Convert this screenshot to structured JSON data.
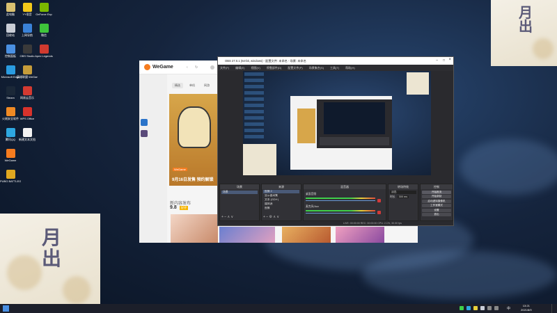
{
  "colors": {
    "wegame_orange": "#f57c1f",
    "obs_bg": "#2a2a2e",
    "record_red": "#d23a3a"
  },
  "desktop_icons": [
    {
      "label": "此电脑",
      "icon": "computer-icon",
      "color": "#d8c070"
    },
    {
      "label": "回收站",
      "icon": "recycle-bin-icon",
      "color": "#c9cdd6"
    },
    {
      "label": "控制面板",
      "icon": "control-panel-icon",
      "color": "#4a90e2"
    },
    {
      "label": "Microsoft Edge",
      "icon": "edge-icon",
      "color": "#2a9be0"
    },
    {
      "label": "Steam",
      "icon": "steam-icon",
      "color": "#1b2838"
    },
    {
      "label": "火绒安全软件",
      "icon": "huorong-icon",
      "color": "#f08a24"
    },
    {
      "label": "腾讯QQ",
      "icon": "qq-icon",
      "color": "#2ea7e0"
    },
    {
      "label": "WeGame",
      "icon": "wegame-icon",
      "color": "#f57c1f"
    },
    {
      "label": "PUBG BATTLEGR",
      "icon": "pubg-icon",
      "color": "#e0a820"
    },
    {
      "label": "YY语音",
      "icon": "yy-icon",
      "color": "#f2c81a"
    },
    {
      "label": "上网导航",
      "icon": "browser-icon",
      "color": "#3a82d8"
    },
    {
      "label": "OBS Studio",
      "icon": "obs-icon",
      "color": "#3a3a3a"
    },
    {
      "label": "英雄联盟 WeGame版",
      "icon": "lol-icon",
      "color": "#c59c3a"
    },
    {
      "label": "网易云音乐",
      "icon": "netease-music-icon",
      "color": "#d33a31"
    },
    {
      "label": "WPS Office",
      "icon": "wps-icon",
      "color": "#d8332c"
    },
    {
      "label": "新建文本文档",
      "icon": "text-doc-icon",
      "color": "#f3f3f3"
    },
    {
      "label": "微信",
      "icon": "wechat-icon",
      "color": "#3ec43b"
    },
    {
      "label": "Apex Legends",
      "icon": "apex-icon",
      "color": "#d03a2f"
    },
    {
      "label": "GeForce Exp",
      "icon": "geforce-icon",
      "color": "#7ab800"
    }
  ],
  "wegame": {
    "logo": "WeGame",
    "nav": [
      "推荐",
      "游戏",
      "商店"
    ],
    "tabs": [
      "精选",
      "单机",
      "网游"
    ],
    "banner_badge": "WeGame",
    "banner_caption": "9月16日发售 预约解锁",
    "section_title": "新内容发布",
    "rating": "9.8",
    "rating_badge": "好评"
  },
  "obs": {
    "title": "OBS 27.0.1 (64-bit, windows) - 配置文件: 未命名 - 场景: 未命名",
    "menu": [
      "文件(F)",
      "编辑(E)",
      "视图(V)",
      "停靠部件(D)",
      "配置文件(P)",
      "场景集合(S)",
      "工具(T)",
      "帮助(H)"
    ],
    "docks": {
      "scenes": "场景",
      "sources": "来源",
      "mixer": "混音器",
      "transitions": "转场特效",
      "controls": "控制"
    },
    "scene_item": "场景",
    "sources": [
      "图像 2",
      "显示器采集",
      "文本 (GDI+)",
      "媒体源",
      "图像"
    ],
    "mixer_tracks": [
      "桌面音频",
      "麦克风/Aux"
    ],
    "transition": {
      "type": "淡出",
      "duration_label": "时长",
      "duration": "300 ms"
    },
    "controls": [
      "开始推流",
      "开始录制",
      "启动虚拟摄像机",
      "工作室模式",
      "设置",
      "退出"
    ],
    "status": "LIVE: 00:00:00  REC: 00:00:00  CPU: 2.1%, 30.00 fps"
  },
  "taskbar": {
    "time": "13:21",
    "date": "2021/8/9",
    "lang": "中"
  }
}
